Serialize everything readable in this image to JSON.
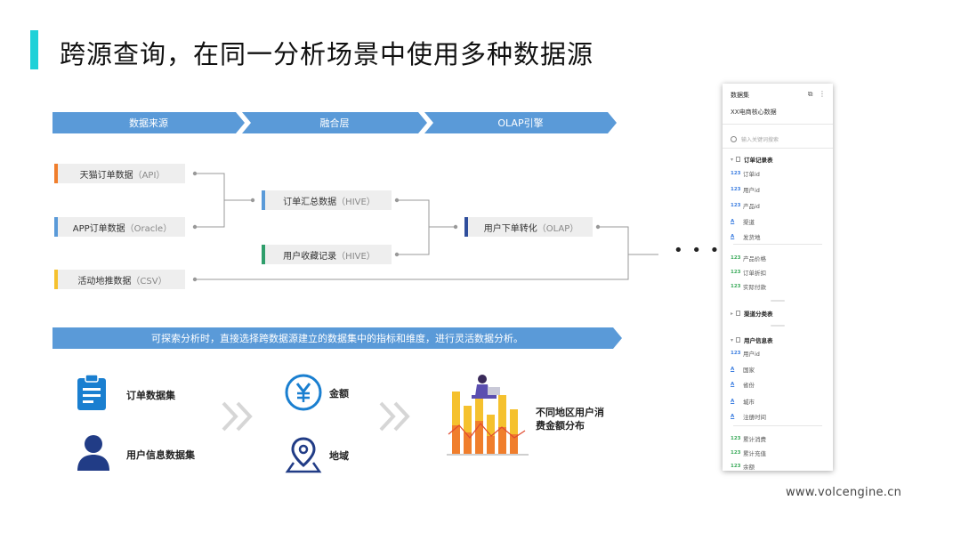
{
  "title": "跨源查询，在同一分析场景中使用多种数据源",
  "stages": [
    "数据来源",
    "融合层",
    "OLAP引擎"
  ],
  "sources": [
    {
      "name": "天猫订单数据",
      "sub": "（API）",
      "color": "#f07e2c"
    },
    {
      "name": "APP订单数据",
      "sub": "（Oracle）",
      "color": "#5a9ad8"
    },
    {
      "name": "活动地推数据",
      "sub": "（CSV）",
      "color": "#f5c12e"
    }
  ],
  "fusion": [
    {
      "name": "订单汇总数据",
      "sub": "（HIVE）",
      "color": "#5a9ad8"
    },
    {
      "name": "用户收藏记录",
      "sub": "（HIVE）",
      "color": "#2f9e6b"
    }
  ],
  "olap": {
    "name": "用户下单转化",
    "sub": "（OLAP）",
    "color": "#2f4e9c"
  },
  "ellipsis": "• • •",
  "banner": "可探索分析时，直接选择跨数据源建立的数据集中的指标和维度，进行灵活数据分析。",
  "datasets": [
    "订单数据集",
    "用户信息数据集"
  ],
  "fields": [
    "金额",
    "地域"
  ],
  "result": [
    "不同地区用户消",
    "费金额分布"
  ],
  "panel": {
    "header": "数据集",
    "subtitle": "XX电商核心数据",
    "search_placeholder": "输入关键词搜索",
    "table1": "订单记录表",
    "t1_fields": [
      {
        "icon": "123",
        "name": "订单id",
        "kind": "dim"
      },
      {
        "icon": "123",
        "name": "用户id",
        "kind": "dim"
      },
      {
        "icon": "123",
        "name": "产品id",
        "kind": "dim"
      },
      {
        "icon": "A",
        "name": "渠道",
        "kind": "dim"
      },
      {
        "icon": "A",
        "name": "发货地",
        "kind": "dim"
      }
    ],
    "t1_measures": [
      {
        "icon": "123",
        "name": "产品价格",
        "kind": "measure"
      },
      {
        "icon": "123",
        "name": "订单折扣",
        "kind": "measure"
      },
      {
        "icon": "123",
        "name": "实际付款",
        "kind": "measure"
      }
    ],
    "table2": "渠道分类表",
    "table3": "用户信息表",
    "t3_fields": [
      {
        "icon": "123",
        "name": "用户id",
        "kind": "dim"
      },
      {
        "icon": "A",
        "name": "国家",
        "kind": "dim"
      },
      {
        "icon": "A",
        "name": "省份",
        "kind": "dim"
      },
      {
        "icon": "A",
        "name": "城市",
        "kind": "dim"
      },
      {
        "icon": "A",
        "name": "注册时间",
        "kind": "dim"
      }
    ],
    "t3_measures": [
      {
        "icon": "123",
        "name": "累计消费",
        "kind": "measure"
      },
      {
        "icon": "123",
        "name": "累计充值",
        "kind": "measure"
      },
      {
        "icon": "123",
        "name": "余额",
        "kind": "measure"
      }
    ]
  },
  "colors": {
    "accent": "#1fd1d8",
    "arrow": "#5a9ad8",
    "icon_blue": "#1a7fd0",
    "icon_navy": "#213c86",
    "dim_icon": "#3b7de0",
    "measure_icon": "#3aaa5a"
  },
  "footer": "www.volcengine.cn"
}
